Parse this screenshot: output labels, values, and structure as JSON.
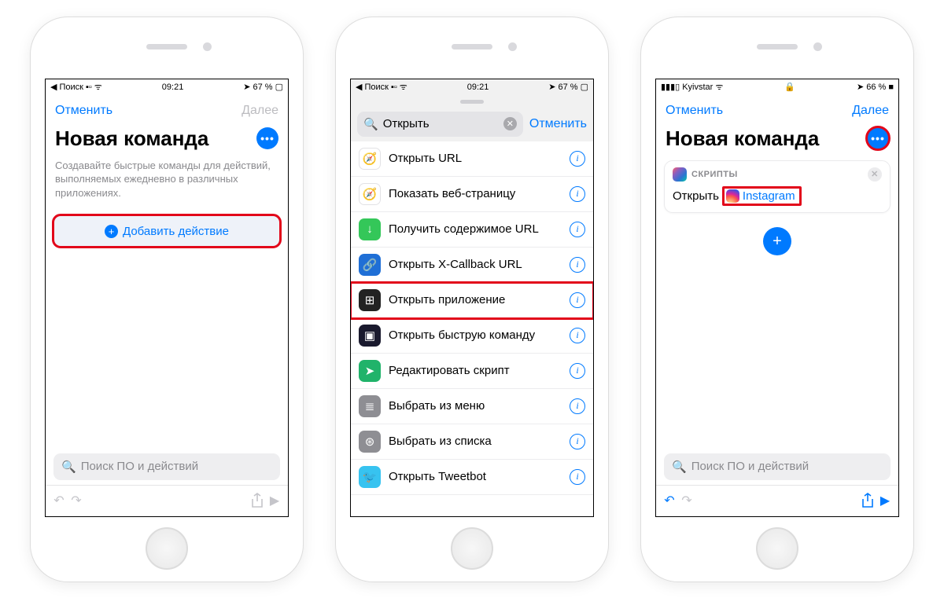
{
  "phone1": {
    "status": {
      "back": "Поиск",
      "time": "09:21",
      "battery": "67 %"
    },
    "nav": {
      "cancel": "Отменить",
      "next": "Далее"
    },
    "title": "Новая команда",
    "subtitle": "Создавайте быстрые команды для действий, выполняемых ежедневно в различных приложениях.",
    "addAction": "Добавить действие",
    "searchPlaceholder": "Поиск ПО и действий"
  },
  "phone2": {
    "status": {
      "back": "Поиск",
      "time": "09:21",
      "battery": "67 %"
    },
    "searchValue": "Открыть",
    "cancel": "Отменить",
    "rows": [
      {
        "label": "Открыть URL",
        "iconBg": "#fff",
        "iconSym": "🧭",
        "textColor": "#1f6fd6"
      },
      {
        "label": "Показать веб-страницу",
        "iconBg": "#fff",
        "iconSym": "🧭",
        "textColor": "#1f6fd6"
      },
      {
        "label": "Получить содержимое URL",
        "iconBg": "#34c759",
        "iconSym": "↓"
      },
      {
        "label": "Открыть X-Callback URL",
        "iconBg": "#1f6fd6",
        "iconSym": "🔗"
      },
      {
        "label": "Открыть приложение",
        "iconBg": "#222",
        "iconSym": "⊞",
        "hl": true
      },
      {
        "label": "Открыть быструю команду",
        "iconBg": "#1a1a2e",
        "iconSym": "▣"
      },
      {
        "label": "Редактировать скрипт",
        "iconBg": "#20b36a",
        "iconSym": "➤"
      },
      {
        "label": "Выбрать из меню",
        "iconBg": "#8e8e93",
        "iconSym": "≣"
      },
      {
        "label": "Выбрать из списка",
        "iconBg": "#8e8e93",
        "iconSym": "⊛"
      },
      {
        "label": "Открыть Tweetbot",
        "iconBg": "#37c3f0",
        "iconSym": "🐦"
      }
    ]
  },
  "phone3": {
    "status": {
      "carrier": "Kyivstar",
      "battery": "66 %"
    },
    "nav": {
      "cancel": "Отменить",
      "next": "Далее"
    },
    "title": "Новая команда",
    "card": {
      "section": "СКРИПТЫ",
      "verb": "Открыть",
      "app": "Instagram"
    },
    "searchPlaceholder": "Поиск ПО и действий"
  }
}
